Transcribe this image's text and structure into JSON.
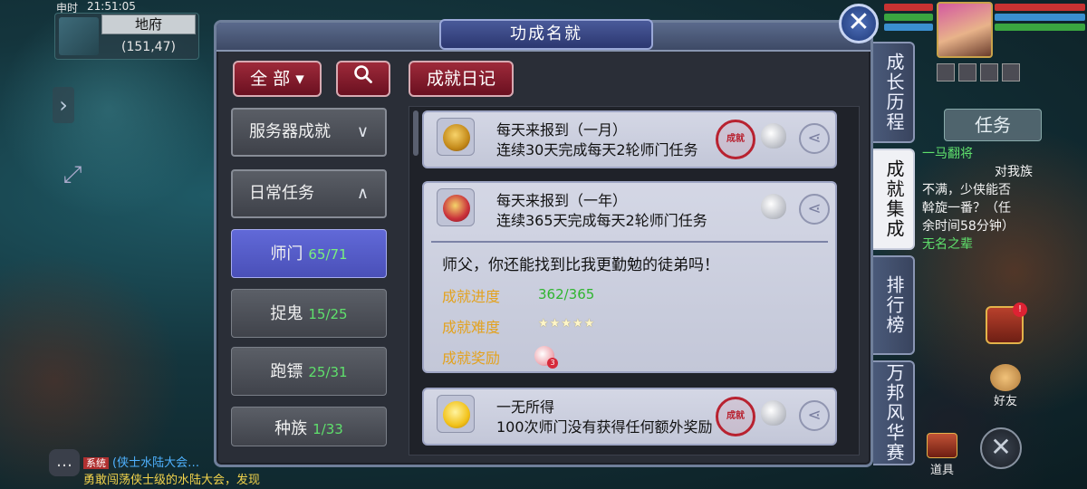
{
  "hud": {
    "shichen": "申时",
    "clock": "21:51:05",
    "map_name": "地府",
    "coords": "(151,47)",
    "task_tab": "任务",
    "task_lines": [
      {
        "text": "一马翻将",
        "green": true
      },
      {
        "text": "对我族",
        "green": false
      },
      {
        "text": "不满，少侠能否",
        "green": false
      },
      {
        "text": "斡旋一番？（任",
        "green": false
      },
      {
        "text": "余时间58分钟）",
        "green": false
      },
      {
        "text": "无名之辈",
        "green": true
      }
    ],
    "chest_badge": "!",
    "friend_label": "好友",
    "item_label": "道具",
    "chat_tag": "系统",
    "chat_line1": "(侠士水陆大会…",
    "chat_line2": "勇敢闯荡侠士级的水陆大会，发现"
  },
  "dialog": {
    "title": "功成名就",
    "filter_label": "全 部",
    "filter_chevron": "▾",
    "search_icon": "search-icon",
    "diary_label": "成就日记",
    "categories": [
      {
        "label": "服务器成就",
        "chevron": "∨"
      },
      {
        "label": "日常任务",
        "chevron": "∧"
      }
    ],
    "subcategories": [
      {
        "label": "师门",
        "count": "65/71",
        "active": true
      },
      {
        "label": "捉鬼",
        "count": "15/25",
        "active": false
      },
      {
        "label": "跑镖",
        "count": "25/31",
        "active": false
      },
      {
        "label": "种族",
        "count": "1/33",
        "active": false
      }
    ],
    "achievements": [
      {
        "title": "每天来报到（一月）",
        "desc": "连续30天完成每天2轮师门任务",
        "icon": "gold-cauldron-icon",
        "completed_seal": true
      },
      {
        "title": "每天来报到（一年）",
        "desc": "连续365天完成每天2轮师门任务",
        "icon": "red-cauldron-icon",
        "completed_seal": false,
        "quote": "师父，你还能找到比我更勤勉的徒弟吗！",
        "progress_label": "成就进度",
        "progress_value": "362/365",
        "difficulty_label": "成就难度",
        "difficulty_stars": "★★★★★",
        "reward_label": "成就奖励",
        "reward_count": "3"
      },
      {
        "title": "一无所得",
        "desc": "100次师门没有获得任何额外奖励",
        "icon": "crying-face-icon",
        "completed_seal": true
      }
    ],
    "seal_text": "成就"
  },
  "side_tabs": [
    {
      "label": "成长历程",
      "active": false
    },
    {
      "label": "成就集成",
      "active": true
    },
    {
      "label": "排行榜",
      "active": false
    },
    {
      "label": "万邦风华赛",
      "active": false
    }
  ],
  "colors": {
    "accent_blue": "#4a50b8",
    "button_red": "#9e2a3a",
    "count_green": "#5fe06c",
    "label_orange": "#e3a21f"
  }
}
